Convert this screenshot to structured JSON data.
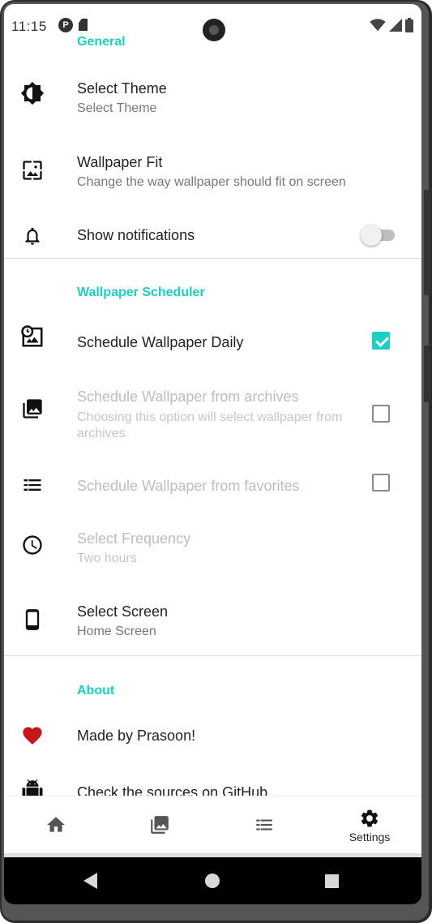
{
  "status_bar": {
    "time": "11:15"
  },
  "colors": {
    "accent": "#1ccfc4",
    "heart": "#c4161c"
  },
  "sections": {
    "general": {
      "header": "General",
      "select_theme": {
        "title": "Select Theme",
        "summary": "Select Theme",
        "icon": "brightness-icon"
      },
      "wallpaper_fit": {
        "title": "Wallpaper Fit",
        "summary": "Change the way wallpaper should fit on screen",
        "icon": "wallpaper-icon"
      },
      "show_notifications": {
        "title": "Show notifications",
        "icon": "bell-icon",
        "enabled": false
      }
    },
    "scheduler": {
      "header": "Wallpaper Scheduler",
      "schedule_daily": {
        "title": "Schedule Wallpaper Daily",
        "checked": true,
        "icon": "schedule-wallpaper-icon"
      },
      "from_archives": {
        "title": "Schedule Wallpaper from archives",
        "summary": "Choosing this option will select wallpaper from archives",
        "checked": false,
        "icon": "photo-library-icon"
      },
      "from_favorites": {
        "title": "Schedule Wallpaper from favorites",
        "checked": false,
        "icon": "list-icon"
      },
      "frequency": {
        "title": "Select Frequency",
        "summary": "Two hours",
        "icon": "clock-icon"
      },
      "screen": {
        "title": "Select Screen",
        "summary": "Home Screen",
        "icon": "phone-icon"
      }
    },
    "about": {
      "header": "About",
      "made_by": {
        "title": "Made by Prasoon!",
        "icon": "heart-icon"
      },
      "github": {
        "title": "Check the sources on GitHub.",
        "icon": "android-icon"
      }
    }
  },
  "bottom_nav": {
    "items": [
      {
        "icon": "home-icon",
        "label": ""
      },
      {
        "icon": "gallery-icon",
        "label": ""
      },
      {
        "icon": "list-icon",
        "label": ""
      },
      {
        "icon": "settings-icon",
        "label": "Settings",
        "selected": true
      }
    ]
  }
}
